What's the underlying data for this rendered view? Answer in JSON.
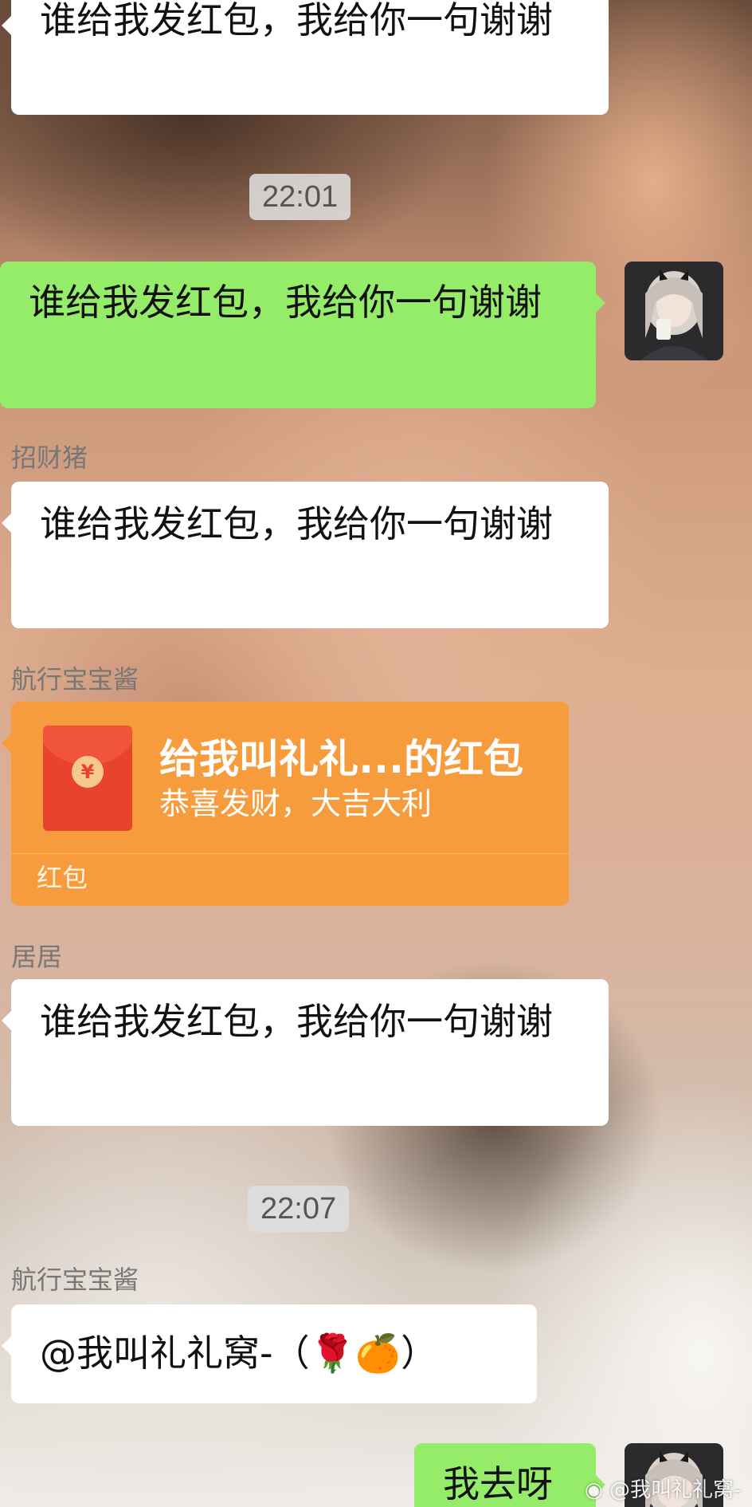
{
  "messages": {
    "m1": {
      "text": "谁给我发红包，我给你一句谢谢"
    },
    "t1": "22:01",
    "m2": {
      "text": "谁给我发红包，我给你一句谢谢"
    },
    "m3": {
      "sender": "招财猪",
      "text": "谁给我发红包，我给你一句谢谢"
    },
    "m4": {
      "sender": "航行宝宝酱",
      "red_packet": {
        "title": "给我叫礼礼...的红包",
        "subtitle": "恭喜发财，大吉大利",
        "label": "红包",
        "coin_symbol": "¥"
      }
    },
    "m5": {
      "sender": "居居",
      "text": "谁给我发红包，我给你一句谢谢"
    },
    "t2": "22:07",
    "m6": {
      "sender": "航行宝宝酱",
      "text": "@我叫礼礼窝-（🌹🍊）"
    },
    "m7": {
      "text": "我去呀"
    }
  },
  "watermark": "@我叫礼礼窝-",
  "colors": {
    "outgoing_bubble": "#95ec69",
    "incoming_bubble": "#ffffff",
    "red_packet": "#f79c3c",
    "envelope": "#e8432c"
  }
}
